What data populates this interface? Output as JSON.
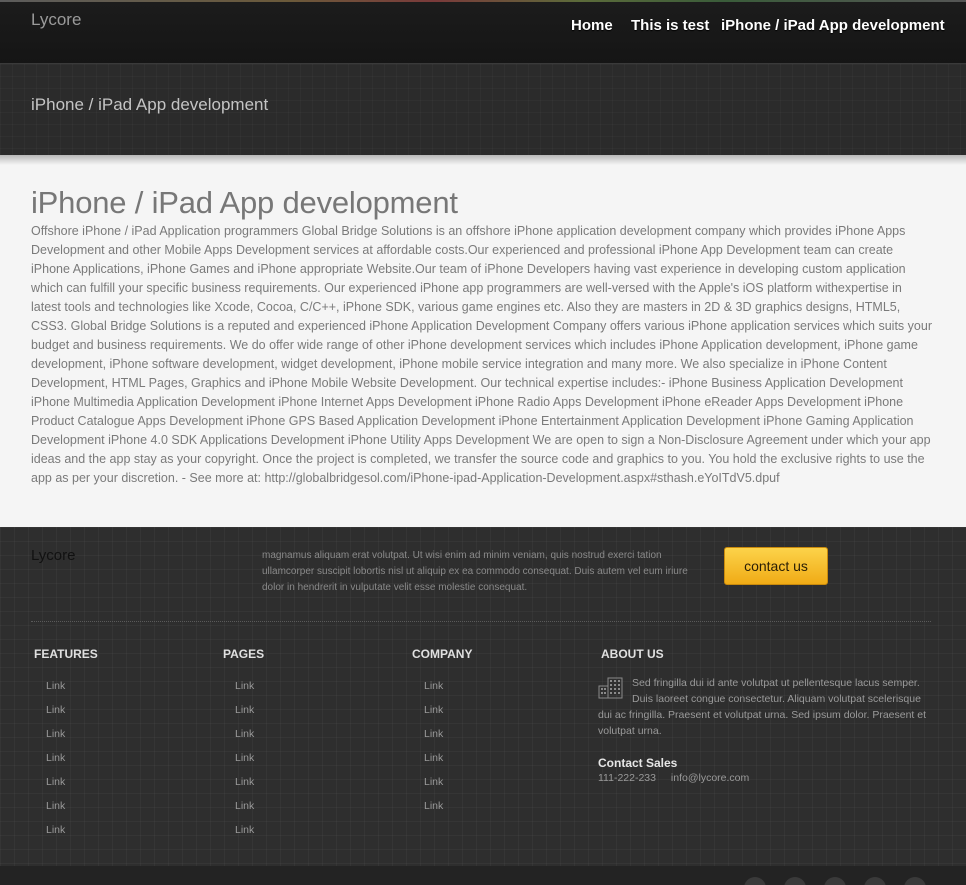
{
  "header": {
    "brand": "Lycore",
    "nav": [
      {
        "label": "Home"
      },
      {
        "label": "This is test"
      },
      {
        "label": "iPhone / iPad App development"
      }
    ]
  },
  "title_bar": {
    "title": "iPhone / iPad App development"
  },
  "main": {
    "heading": "iPhone / iPad App development",
    "body": "Offshore iPhone / iPad Application programmers Global Bridge Solutions is an offshore iPhone application development company which provides iPhone Apps Development and other Mobile Apps Development services at affordable costs.Our experienced and professional iPhone App Development team can create iPhone Applications, iPhone Games and iPhone appropriate Website.Our team of iPhone Developers having vast experience in developing custom application which can fulfill your specific business requirements. Our experienced iPhone app programmers are well-versed with the Apple's iOS platform withexpertise in latest tools and technologies like Xcode, Cocoa, C/C++, iPhone SDK, various game engines etc. Also they are masters in 2D & 3D graphics designs, HTML5, CSS3. Global Bridge Solutions is a reputed and experienced iPhone Application Development Company offers various iPhone application services which suits your budget and business requirements. We do offer wide range of other iPhone development services which includes iPhone Application development, iPhone game development, iPhone software development, widget development, iPhone mobile service integration and many more. We also specialize in iPhone Content Development, HTML Pages, Graphics and iPhone Mobile Website Development. Our technical expertise includes:- iPhone Business Application Development iPhone Multimedia Application Development iPhone Internet Apps Development iPhone Radio Apps Development iPhone eReader Apps Development iPhone Product Catalogue Apps Development iPhone GPS Based Application Development iPhone Entertainment Application Development iPhone Gaming Application Development iPhone 4.0 SDK Applications Development iPhone Utility Apps Development We are open to sign a Non-Disclosure Agreement under which your app ideas and the app stay as your copyright. Once the project is completed, we transfer the source code and graphics to you. You hold the exclusive rights to use the app as per your discretion. - See more at: http://globalbridgesol.com/iPhone-ipad-Application-Development.aspx#sthash.eYoITdV5.dpuf"
  },
  "footer": {
    "brand": "Lycore",
    "blurb": "magnamus aliquam erat volutpat. Ut wisi enim ad minim veniam, quis nostrud exerci tation ullamcorper suscipit lobortis nisl ut aliquip ex ea commodo consequat. Duis autem vel eum iriure dolor in hendrerit in vulputate velit esse molestie consequat.",
    "contact_button": "contact us",
    "columns": [
      {
        "title": "FEATURES",
        "links": [
          "Link",
          "Link",
          "Link",
          "Link",
          "Link",
          "Link",
          "Link"
        ]
      },
      {
        "title": "PAGES",
        "links": [
          "Link",
          "Link",
          "Link",
          "Link",
          "Link",
          "Link",
          "Link"
        ]
      },
      {
        "title": "COMPANY",
        "links": [
          "Link",
          "Link",
          "Link",
          "Link",
          "Link",
          "Link"
        ]
      }
    ],
    "about": {
      "title": "ABOUT US",
      "icon": "building-icon",
      "text": "Sed fringilla dui id ante volutpat ut pellentesque lacus semper. Duis laoreet congue consectetur. Aliquam volutpat scelerisque dui ac fringilla. Praesent et volutpat urna. Sed ipsum dolor. Praesent et volutpat urna.",
      "contact_title": "Contact Sales",
      "phone": "111-222-233",
      "email": "info@lycore.com"
    }
  }
}
